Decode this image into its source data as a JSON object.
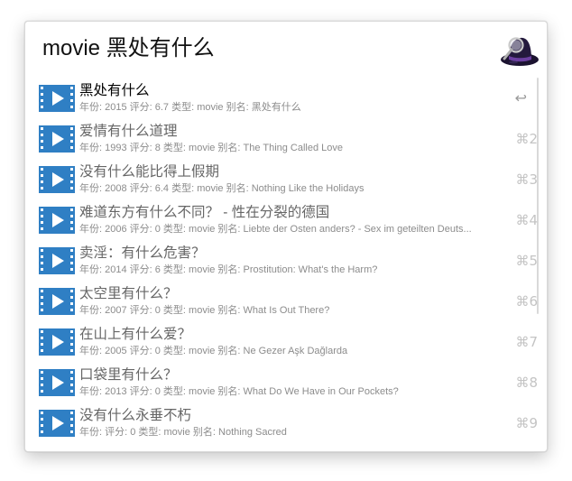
{
  "search": {
    "query": "movie 黑处有什么"
  },
  "app_icon": "alfred-hat-icon",
  "results": [
    {
      "title": "黑处有什么",
      "subtitle": "年份: 2015 评分: 6.7 类型: movie 别名: 黑处有什么",
      "shortcut": "↩",
      "selected": true
    },
    {
      "title": "爱情有什么道理",
      "subtitle": "年份: 1993 评分: 8 类型: movie 别名: The Thing Called Love",
      "shortcut": "⌘2",
      "selected": false
    },
    {
      "title": "没有什么能比得上假期",
      "subtitle": "年份: 2008 评分: 6.4 类型: movie 别名: Nothing Like the Holidays",
      "shortcut": "⌘3",
      "selected": false
    },
    {
      "title": "难道东方有什么不同？ - 性在分裂的德国",
      "subtitle": "年份: 2006 评分: 0 类型: movie 别名: Liebte der Osten anders? - Sex im geteilten Deuts...",
      "shortcut": "⌘4",
      "selected": false
    },
    {
      "title": "卖淫：有什么危害？",
      "subtitle": "年份: 2014 评分: 6 类型: movie 别名: Prostitution: What's the Harm?",
      "shortcut": "⌘5",
      "selected": false
    },
    {
      "title": "太空里有什么？",
      "subtitle": "年份: 2007 评分: 0 类型: movie 别名: What Is Out There?",
      "shortcut": "⌘6",
      "selected": false
    },
    {
      "title": "在山上有什么爱？",
      "subtitle": "年份: 2005 评分: 0 类型: movie 别名: Ne Gezer Aşk Dağlarda",
      "shortcut": "⌘7",
      "selected": false
    },
    {
      "title": "口袋里有什么？",
      "subtitle": "年份: 2013 评分: 0 类型: movie 别名: What Do We Have in Our Pockets?",
      "shortcut": "⌘8",
      "selected": false
    },
    {
      "title": "没有什么永垂不朽",
      "subtitle": "年份: 评分: 0 类型: movie 别名: Nothing Sacred",
      "shortcut": "⌘9",
      "selected": false
    }
  ],
  "result_icon": "film-icon",
  "colors": {
    "film_icon": "#2f7fc4",
    "title_selected": "#000000",
    "title": "#666666",
    "subtitle": "#8c8c8c",
    "shortcut": "#c4c4c4"
  }
}
